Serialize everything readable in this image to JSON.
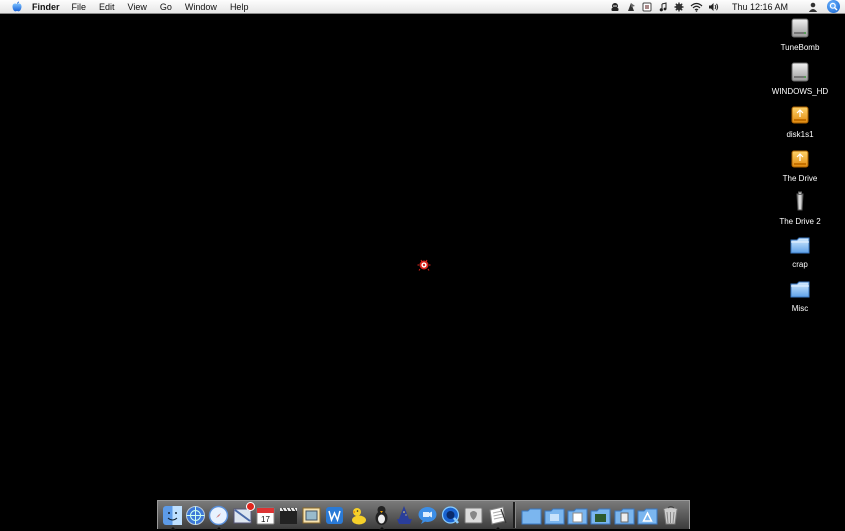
{
  "menubar": {
    "app_name": "Finder",
    "items": [
      "File",
      "Edit",
      "View",
      "Go",
      "Window",
      "Help"
    ],
    "clock": "Thu 12:16 AM",
    "status_icons": [
      "user-status-icon",
      "script-icon",
      "sync-icon",
      "itunes-note-icon",
      "gear-icon",
      "wifi-icon",
      "volume-icon",
      "user-account-icon",
      "spotlight-icon"
    ]
  },
  "desktop": {
    "background_color": "#000000",
    "icons": [
      {
        "label": "TuneBomb",
        "kind": "hard-drive-icon"
      },
      {
        "label": "WINDOWS_HD",
        "kind": "hard-drive-icon"
      },
      {
        "label": "disk1s1",
        "kind": "external-drive-icon"
      },
      {
        "label": "The Drive",
        "kind": "external-drive-icon"
      },
      {
        "label": "The Drive 2",
        "kind": "usb-drive-icon"
      },
      {
        "label": "crap",
        "kind": "folder-icon"
      },
      {
        "label": "Misc",
        "kind": "folder-icon"
      }
    ]
  },
  "dock": {
    "apps": [
      "finder-icon",
      "network-icon",
      "safari-icon",
      "mail-icon",
      "ical-icon",
      "movie-icon",
      "preview-icon",
      "word-icon",
      "duck-icon",
      "adium-icon",
      "wizard-icon",
      "ichat-icon",
      "quicktime-icon",
      "utility-icon",
      "textedit-icon"
    ],
    "stacks": [
      "folder-stack-icon",
      "folder-stack-icon",
      "documents-icon",
      "folder-stack-icon",
      "folder-stack-icon",
      "applications-icon",
      "trash-icon"
    ],
    "mail_badge": "1"
  }
}
